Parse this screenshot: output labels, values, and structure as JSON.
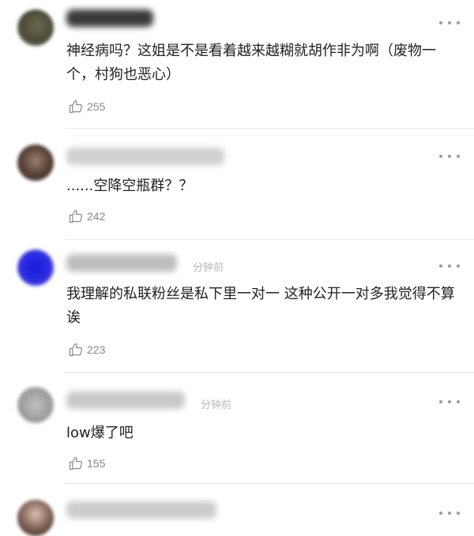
{
  "icons": {
    "more": "more-dots-icon",
    "like": "thumb-up-icon"
  },
  "colors": {
    "text": "#222222",
    "meta": "#888888",
    "divider": "#e9e9e9"
  },
  "comments": [
    {
      "username_visible": "",
      "time": "",
      "text": "神经病吗？这姐是不是看着越来越糊就胡作非为啊（废物一个，村狗也恶心）",
      "likes": "255"
    },
    {
      "username_visible": "",
      "time": "",
      "text": "......空降空瓶群？？",
      "likes": "242"
    },
    {
      "username_visible": "",
      "time": "分钟前",
      "text": "我理解的私联粉丝是私下里一对一 这种公开一对多我觉得不算诶",
      "likes": "223"
    },
    {
      "username_visible": "",
      "time": "分钟前",
      "text": "low爆了吧",
      "likes": "155"
    },
    {
      "username_visible": "",
      "time": "",
      "text": "",
      "likes": ""
    }
  ]
}
